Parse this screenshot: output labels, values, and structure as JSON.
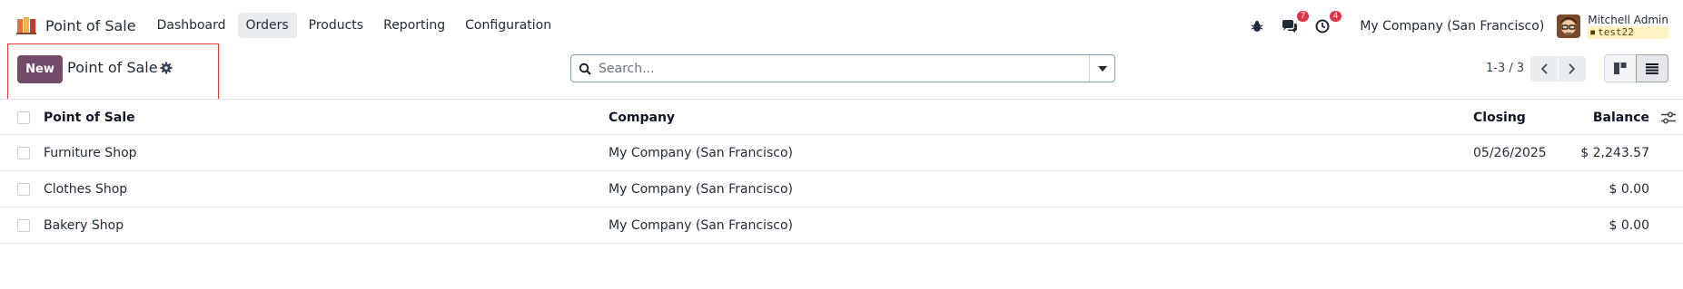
{
  "app": {
    "name": "Point of Sale"
  },
  "menu": [
    {
      "label": "Dashboard",
      "active": false
    },
    {
      "label": "Orders",
      "active": true
    },
    {
      "label": "Products",
      "active": false
    },
    {
      "label": "Reporting",
      "active": false
    },
    {
      "label": "Configuration",
      "active": false
    }
  ],
  "systray": {
    "messages_badge": "7",
    "activity_badge": "4",
    "company": "My Company (San Francisco)",
    "user_name": "Mitchell Admin",
    "database": "test22"
  },
  "control": {
    "new_label": "New",
    "title": "Point of Sale",
    "search_placeholder": "Search...",
    "pager_text": "1-3 / 3"
  },
  "table": {
    "headers": {
      "name": "Point of Sale",
      "company": "Company",
      "closing": "Closing",
      "balance": "Balance"
    },
    "rows": [
      {
        "name": "Furniture Shop",
        "company": "My Company (San Francisco)",
        "closing": "05/26/2025",
        "balance": "$ 2,243.57"
      },
      {
        "name": "Clothes Shop",
        "company": "My Company (San Francisco)",
        "closing": "",
        "balance": "$ 0.00"
      },
      {
        "name": "Bakery Shop",
        "company": "My Company (San Francisco)",
        "closing": "",
        "balance": "$ 0.00"
      }
    ]
  },
  "colors": {
    "primary": "#714b67",
    "badge": "#dc3545",
    "highlight": "#e53935"
  },
  "icons": [
    "pos-app-icon",
    "bug-icon",
    "chat-icon",
    "clock-icon",
    "avatar",
    "gear-icon",
    "search-icon",
    "caret-down-icon",
    "chevron-left-icon",
    "chevron-right-icon",
    "kanban-view-icon",
    "list-view-icon",
    "optional-columns-icon"
  ]
}
